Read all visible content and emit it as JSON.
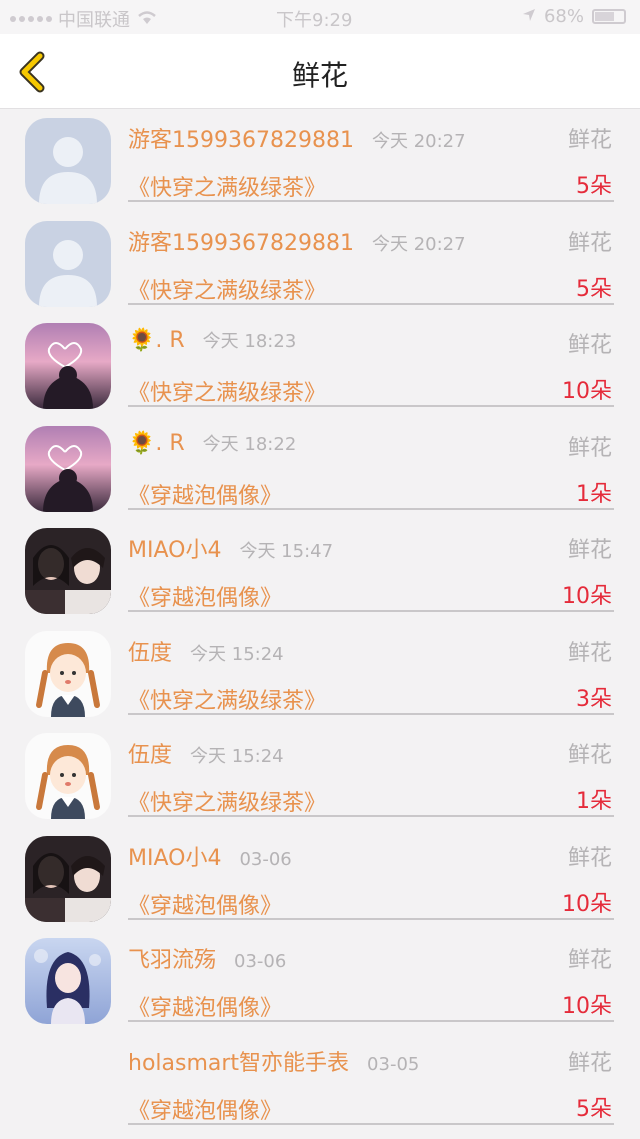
{
  "status": {
    "carrier": "中国联通",
    "time": "下午9:29",
    "battery": "68%",
    "battery_level": 0.68
  },
  "nav": {
    "title": "鲜花",
    "back_icon": "chevron-left-icon",
    "accent": "#f6c800"
  },
  "colors": {
    "name": "#e8924e",
    "count": "#e52b3a",
    "meta": "#b5b3b5"
  },
  "items": [
    {
      "user": "游客1599367829881",
      "time": "今天 20:27",
      "tag": "鲜花",
      "book": "《快穿之满级绿茶》",
      "count": "5朵",
      "avatar": "default-avatar"
    },
    {
      "user": "游客1599367829881",
      "time": "今天 20:27",
      "tag": "鲜花",
      "book": "《快穿之满级绿茶》",
      "count": "5朵",
      "avatar": "default-avatar"
    },
    {
      "user": "🌻. R",
      "time": "今天 18:23",
      "tag": "鲜花",
      "book": "《快穿之满级绿茶》",
      "count": "10朵",
      "avatar": "sunset-heart-avatar"
    },
    {
      "user": "🌻. R",
      "time": "今天 18:22",
      "tag": "鲜花",
      "book": "《穿越泡偶像》",
      "count": "1朵",
      "avatar": "sunset-heart-avatar"
    },
    {
      "user": "MIAO小4",
      "time": "今天 15:47",
      "tag": "鲜花",
      "book": "《穿越泡偶像》",
      "count": "10朵",
      "avatar": "couple-photo-avatar"
    },
    {
      "user": "伍度",
      "time": "今天 15:24",
      "tag": "鲜花",
      "book": "《快穿之满级绿茶》",
      "count": "3朵",
      "avatar": "cartoon-girl-avatar"
    },
    {
      "user": "伍度",
      "time": "今天 15:24",
      "tag": "鲜花",
      "book": "《快穿之满级绿茶》",
      "count": "1朵",
      "avatar": "cartoon-girl-avatar"
    },
    {
      "user": "MIAO小4",
      "time": "03-06",
      "tag": "鲜花",
      "book": "《穿越泡偶像》",
      "count": "10朵",
      "avatar": "couple-photo-avatar"
    },
    {
      "user": "飞羽流殇",
      "time": "03-06",
      "tag": "鲜花",
      "book": "《穿越泡偶像》",
      "count": "10朵",
      "avatar": "anime-girl-avatar"
    },
    {
      "user": "holasmart智亦能手表",
      "time": "03-05",
      "tag": "鲜花",
      "book": "《穿越泡偶像》",
      "count": "5朵",
      "avatar": "none"
    }
  ]
}
